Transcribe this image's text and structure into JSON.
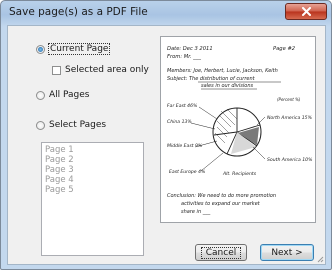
{
  "window": {
    "title": "Save page(s) as a PDF File"
  },
  "options": {
    "current_page": "Current Page",
    "selected_area": "Selected area only",
    "all_pages": "All Pages",
    "select_pages": "Select Pages",
    "selected_option": "current_page",
    "selected_area_checked": false
  },
  "pages_list": [
    "Page 1",
    "Page 2",
    "Page 3",
    "Page 4",
    "Page 5"
  ],
  "buttons": {
    "cancel": "Cancel",
    "next": "Next >"
  },
  "preview_page": {
    "date_line": "Date: Dec 3 2011",
    "page_line": "Page #2",
    "from_line": "From: Mr. ___",
    "members_line": "Members: Joe, Herbert, Lucie, Jackson, Keith",
    "subject_line": "Subject: The distribution of current",
    "subject_line2": "sales in our divisions",
    "scale_label": "(Percent %)",
    "left_labels": [
      "Far East 46%",
      "China 13%",
      "Middle East 9%",
      "East Europe 4%"
    ],
    "right_labels": [
      "North America 15%",
      "South America 10%",
      "Alt. Recipients"
    ],
    "notes": [
      "Conclusion: We need to do more promotion",
      "activities to expand our market",
      "share in ___"
    ]
  },
  "colors": {
    "titlebar": "#b9d1ea",
    "client": "#f0f0f0",
    "close_button": "#c8442c"
  }
}
